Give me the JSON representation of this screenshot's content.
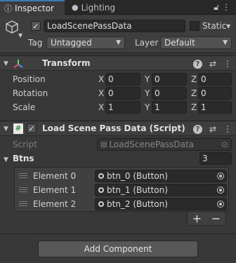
{
  "tabs": [
    {
      "label": "Inspector",
      "icon": "info-icon"
    },
    {
      "label": "Lighting",
      "icon": "bulb-icon"
    }
  ],
  "tab_icons": {
    "lock": "lock-icon",
    "menu": "more-vert-icon"
  },
  "gameobject": {
    "active": true,
    "name": "LoadScenePassData",
    "static_label": "Static",
    "static_checked": false,
    "tag_label": "Tag",
    "tag_value": "Untagged",
    "layer_label": "Layer",
    "layer_value": "Default"
  },
  "transform": {
    "title": "Transform",
    "rows": [
      {
        "label": "Position",
        "x": "0",
        "y": "0",
        "z": "0"
      },
      {
        "label": "Rotation",
        "x": "0",
        "y": "0",
        "z": "0"
      },
      {
        "label": "Scale",
        "x": "1",
        "y": "1",
        "z": "1"
      }
    ],
    "axis_labels": [
      "X",
      "Y",
      "Z"
    ]
  },
  "script_component": {
    "title": "Load Scene Pass Data (Script)",
    "enabled": true,
    "script_label": "Script",
    "script_value": "LoadScenePassData",
    "list_label": "Btns",
    "list_size": "3",
    "elements": [
      {
        "label": "Element 0",
        "value": "btn_0 (Button)"
      },
      {
        "label": "Element 1",
        "value": "btn_1 (Button)"
      },
      {
        "label": "Element 2",
        "value": "btn_2 (Button)"
      }
    ],
    "add_symbol": "+",
    "remove_symbol": "−"
  },
  "add_component_label": "Add Component",
  "colors": {
    "background": "#383838",
    "header": "#3e3e3e",
    "field": "#2a2a2a",
    "accent": "#3a79bb"
  }
}
